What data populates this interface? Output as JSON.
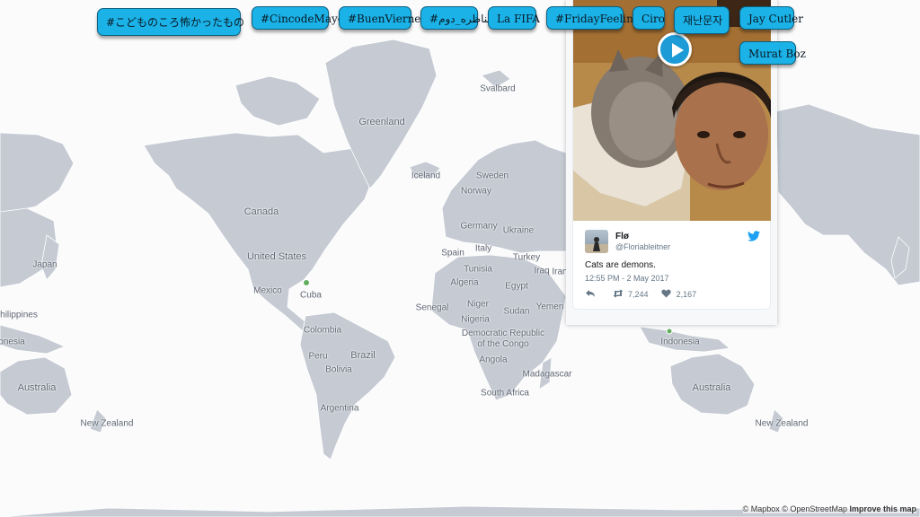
{
  "trending_tags": [
    "#こどものころ怖かったもの",
    "#CincodeMayo",
    "#BuenViernes",
    "#مناظره_دوم",
    "La FIFA",
    "#FridayFeeling",
    "Ciro",
    "재난문자",
    "Jay Cutler",
    "Murat Boz"
  ],
  "map_labels": {
    "svalbard": "Svalbard",
    "greenland": "Greenland",
    "iceland": "Iceland",
    "sweden": "Sweden",
    "norway": "Norway",
    "canada": "Canada",
    "germany": "Germany",
    "ukraine": "Ukraine",
    "italy": "Italy",
    "spain": "Spain",
    "turkey": "Turkey",
    "tunisia": "Tunisia",
    "iraq": "Iraq",
    "iran": "Iran",
    "algeria": "Algeria",
    "egypt": "Egypt",
    "united_states": "United States",
    "japan": "Japan",
    "mexico": "Mexico",
    "cuba": "Cuba",
    "philippines": "hilippines",
    "senegal": "Senegal",
    "niger": "Niger",
    "sudan": "Sudan",
    "yemen": "Yemen",
    "nigeria": "Nigeria",
    "colombia": "Colombia",
    "drc": "Democratic Republic of the Congo",
    "indonesia_left": "onesia",
    "indonesia_right": "Indonesia",
    "peru": "Peru",
    "brazil": "Brazil",
    "angola": "Angola",
    "bolivia": "Bolivia",
    "madagascar": "Madagascar",
    "australia_left": "Australia",
    "australia_right": "Australia",
    "south_africa": "South Africa",
    "argentina": "Argentina",
    "new_zealand_left": "New Zealand",
    "new_zealand_right": "New Zealand"
  },
  "tweet": {
    "display_name": "Flø",
    "handle": "@Floriableitner",
    "text": "Cats are demons.",
    "timestamp": "12:55 PM - 2 May 2017",
    "retweets": "7,244",
    "likes": "2,167"
  },
  "attribution": {
    "mapbox": "© Mapbox",
    "osm": "© OpenStreetMap",
    "improve": "Improve this map"
  },
  "colors": {
    "land": "#c5cad3",
    "pill": "#1bb2e8",
    "pill_border": "#0d5f7f",
    "marker": "#5fae5f",
    "twitter_blue": "#1da1f2"
  },
  "icons": [
    "play-icon",
    "twitter-bird-icon",
    "reply-icon",
    "retweet-icon",
    "heart-icon"
  ]
}
